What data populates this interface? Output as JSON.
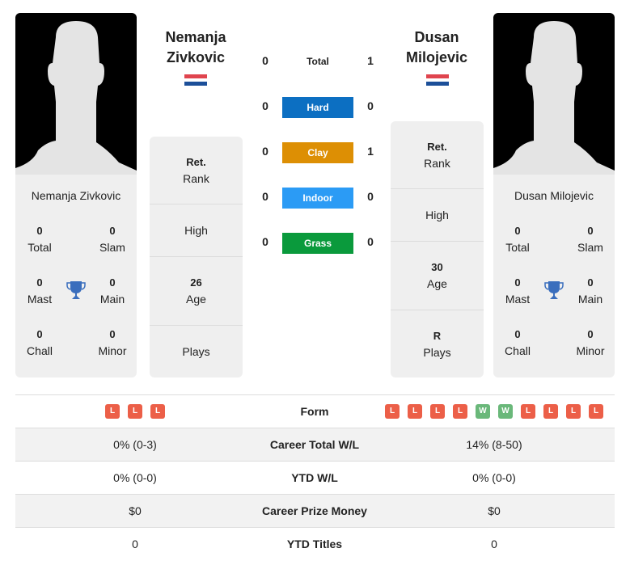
{
  "colors": {
    "hard": "#0c6fc2",
    "clay": "#dd8f04",
    "indoor": "#2b9bf5",
    "grass": "#0a9a3c",
    "loss": "#ec5f48",
    "win": "#6ab87a",
    "trophy": "#3a6ebd"
  },
  "player1": {
    "name_line1": "Nemanja",
    "name_line2": "Zivkovic",
    "card_name": "Nemanja Zivkovic",
    "flag": "serbia-flag",
    "stats": {
      "total": {
        "value": "0",
        "label": "Total"
      },
      "slam": {
        "value": "0",
        "label": "Slam"
      },
      "mast": {
        "value": "0",
        "label": "Mast"
      },
      "main": {
        "value": "0",
        "label": "Main"
      },
      "chall": {
        "value": "0",
        "label": "Chall"
      },
      "minor": {
        "value": "0",
        "label": "Minor"
      }
    },
    "info": {
      "rank": {
        "value": "Ret.",
        "label": "Rank"
      },
      "high": {
        "value": "",
        "label": "High"
      },
      "age": {
        "value": "26",
        "label": "Age"
      },
      "plays": {
        "value": "",
        "label": "Plays"
      }
    }
  },
  "player2": {
    "name_line1": "Dusan",
    "name_line2": "Milojevic",
    "card_name": "Dusan Milojevic",
    "flag": "serbia-flag",
    "stats": {
      "total": {
        "value": "0",
        "label": "Total"
      },
      "slam": {
        "value": "0",
        "label": "Slam"
      },
      "mast": {
        "value": "0",
        "label": "Mast"
      },
      "main": {
        "value": "0",
        "label": "Main"
      },
      "chall": {
        "value": "0",
        "label": "Chall"
      },
      "minor": {
        "value": "0",
        "label": "Minor"
      }
    },
    "info": {
      "rank": {
        "value": "Ret.",
        "label": "Rank"
      },
      "high": {
        "value": "",
        "label": "High"
      },
      "age": {
        "value": "30",
        "label": "Age"
      },
      "plays": {
        "value": "R",
        "label": "Plays"
      }
    }
  },
  "h2h": {
    "total": {
      "label": "Total",
      "p1": "0",
      "p2": "1"
    },
    "surfaces": [
      {
        "label": "Hard",
        "p1": "0",
        "p2": "0",
        "color_key": "hard"
      },
      {
        "label": "Clay",
        "p1": "0",
        "p2": "1",
        "color_key": "clay"
      },
      {
        "label": "Indoor",
        "p1": "0",
        "p2": "0",
        "color_key": "indoor"
      },
      {
        "label": "Grass",
        "p1": "0",
        "p2": "0",
        "color_key": "grass"
      }
    ]
  },
  "comparison": {
    "form": {
      "label": "Form",
      "p1": [
        "L",
        "L",
        "L"
      ],
      "p2": [
        "L",
        "L",
        "L",
        "L",
        "W",
        "W",
        "L",
        "L",
        "L",
        "L"
      ]
    },
    "rows": [
      {
        "label": "Career Total W/L",
        "p1": "0% (0-3)",
        "p2": "14% (8-50)"
      },
      {
        "label": "YTD W/L",
        "p1": "0% (0-0)",
        "p2": "0% (0-0)"
      },
      {
        "label": "Career Prize Money",
        "p1": "$0",
        "p2": "$0"
      },
      {
        "label": "YTD Titles",
        "p1": "0",
        "p2": "0"
      }
    ]
  }
}
